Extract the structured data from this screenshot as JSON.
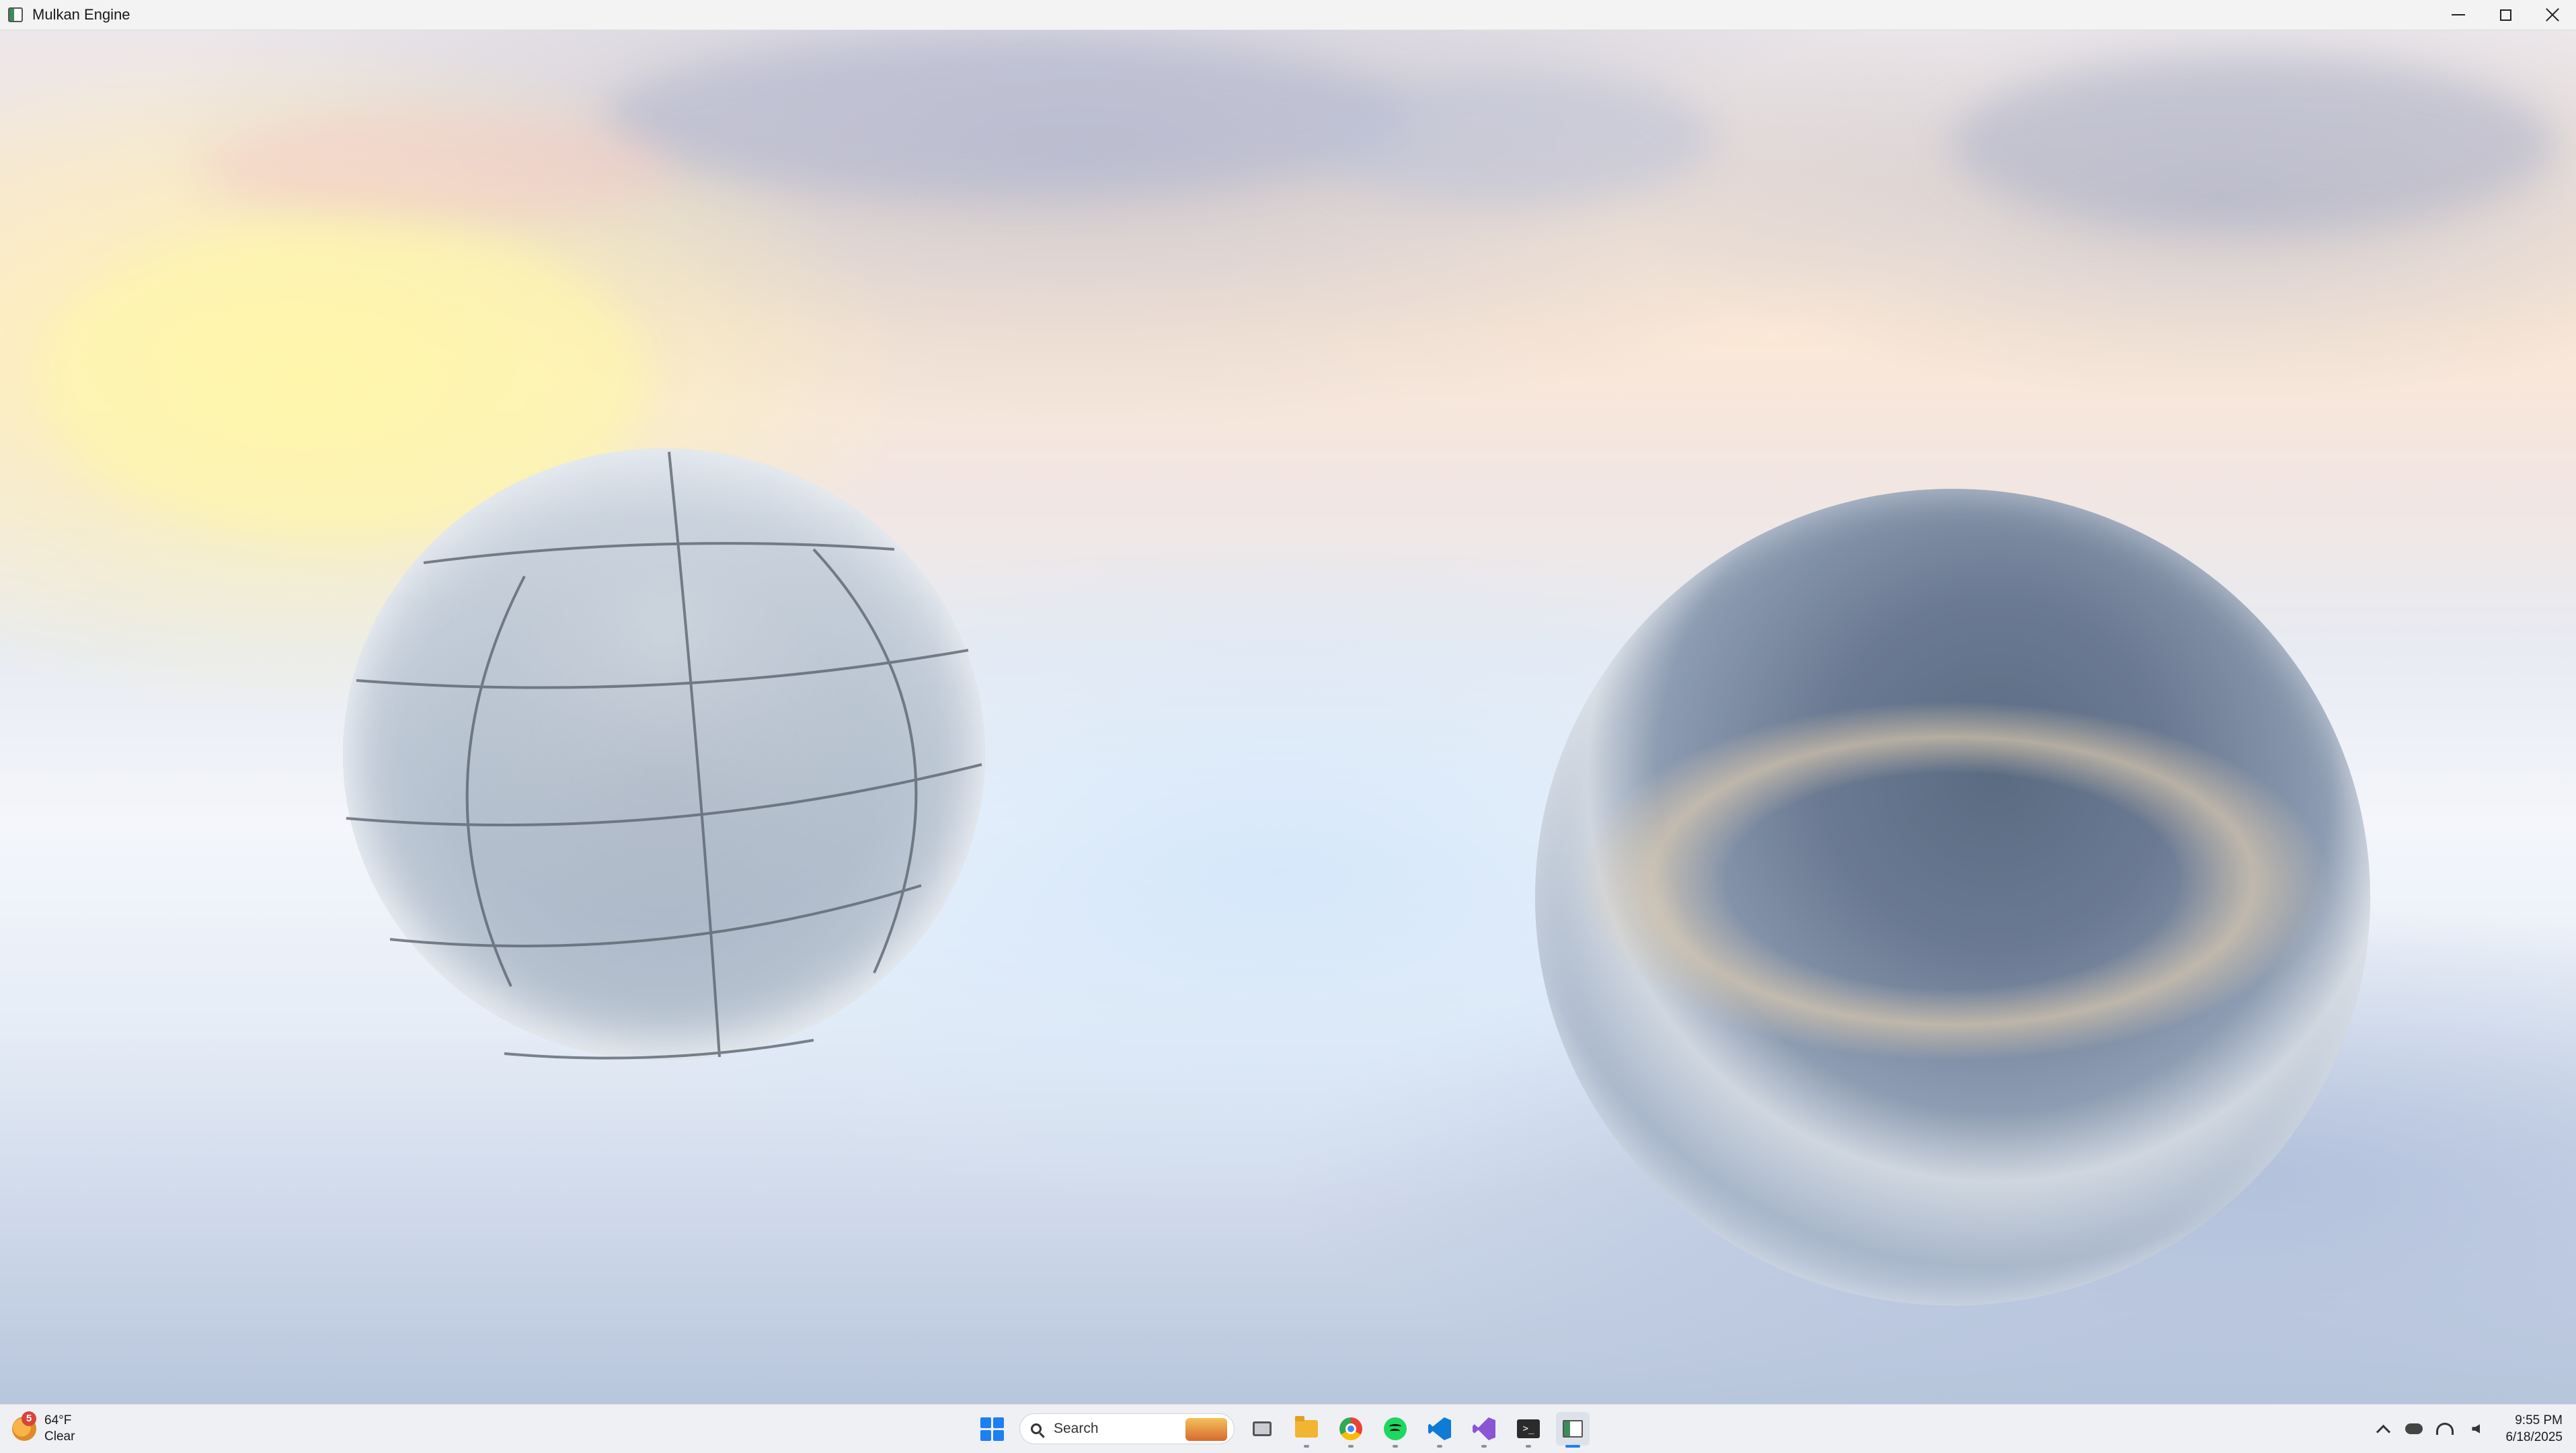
{
  "window": {
    "title": "Mulkan Engine",
    "controls": {
      "minimize": "minimize-icon",
      "maximize": "maximize-icon",
      "close": "close-icon"
    }
  },
  "scene": {
    "objects": [
      "grid-sphere",
      "chrome-sphere"
    ],
    "sky_colors": {
      "sun": "#fff3a6",
      "cloud": "#aab0c8",
      "horizon": "#e8ebf2",
      "floor": "#cfd9ea"
    }
  },
  "taskbar": {
    "weather": {
      "temperature": "64°F",
      "condition": "Clear",
      "badge": "5"
    },
    "search": {
      "placeholder": "Search"
    },
    "pinned_apps": [
      {
        "name": "Start",
        "icon": "windows-start-icon"
      },
      {
        "name": "Task View",
        "icon": "task-view-icon"
      },
      {
        "name": "File Explorer",
        "icon": "folder-icon"
      },
      {
        "name": "Google Chrome",
        "icon": "chrome-icon"
      },
      {
        "name": "Spotify",
        "icon": "spotify-icon"
      },
      {
        "name": "Visual Studio Code",
        "icon": "vscode-icon"
      },
      {
        "name": "Visual Studio",
        "icon": "visual-studio-icon"
      },
      {
        "name": "Terminal",
        "icon": "terminal-icon"
      },
      {
        "name": "Mulkan Engine",
        "icon": "engine-app-icon"
      }
    ],
    "clock": {
      "time": "9:55 PM",
      "date": "6/18/2025"
    },
    "accent": "#1d7ff0"
  }
}
